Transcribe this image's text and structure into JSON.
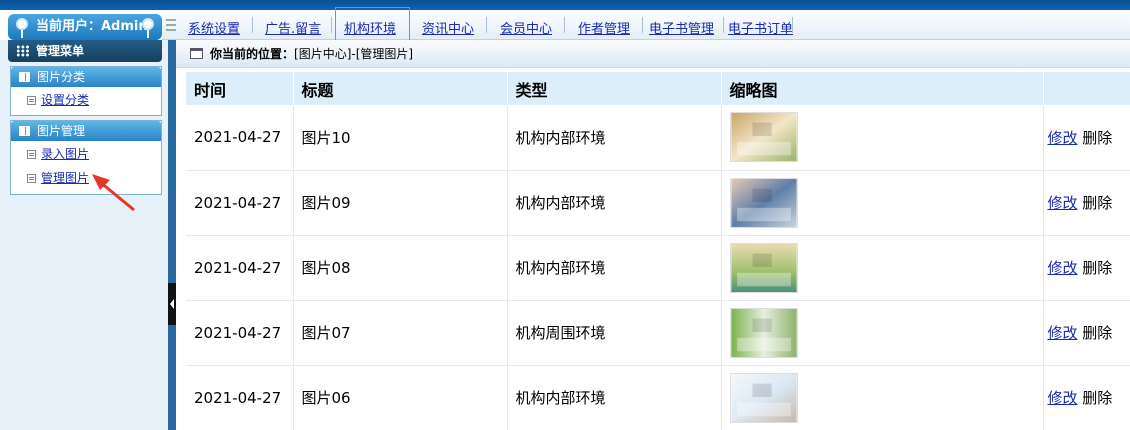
{
  "header": {
    "user_label": "当前用户：Admin"
  },
  "nav": {
    "items": [
      "系统设置",
      "广告.留言",
      "机构环境",
      "资讯中心",
      "会员中心",
      "作者管理",
      "电子书管理",
      "电子书订单"
    ],
    "active_index": 2
  },
  "sidebar": {
    "title": "管理菜单",
    "panels": [
      {
        "title": "图片分类",
        "links": [
          "设置分类"
        ]
      },
      {
        "title": "图片管理",
        "links": [
          "录入图片",
          "管理图片"
        ]
      }
    ]
  },
  "breadcrumb": {
    "label": "你当前的位置：",
    "path": "[图片中心]-[管理图片]"
  },
  "table": {
    "columns": [
      "时间",
      "标题",
      "类型",
      "缩略图",
      ""
    ],
    "rows": [
      {
        "time": "2021-04-27",
        "title": "图片10",
        "type": "机构内部环境",
        "thumb": "corridor",
        "edit": "修改",
        "delete": "删除"
      },
      {
        "time": "2021-04-27",
        "title": "图片09",
        "type": "机构内部环境",
        "thumb": "playroom",
        "edit": "修改",
        "delete": "删除"
      },
      {
        "time": "2021-04-27",
        "title": "图片08",
        "type": "机构内部环境",
        "thumb": "classroom",
        "edit": "修改",
        "delete": "删除"
      },
      {
        "time": "2021-04-27",
        "title": "图片07",
        "type": "机构周围环境",
        "thumb": "room",
        "edit": "修改",
        "delete": "删除"
      },
      {
        "time": "2021-04-27",
        "title": "图片06",
        "type": "机构内部环境",
        "thumb": "wall",
        "edit": "修改",
        "delete": "删除"
      }
    ]
  },
  "colors": {
    "accent": "#1e78bf",
    "link": "#1a2bb0",
    "header_row": "#dbeefa",
    "arrow": "#e8352b"
  }
}
